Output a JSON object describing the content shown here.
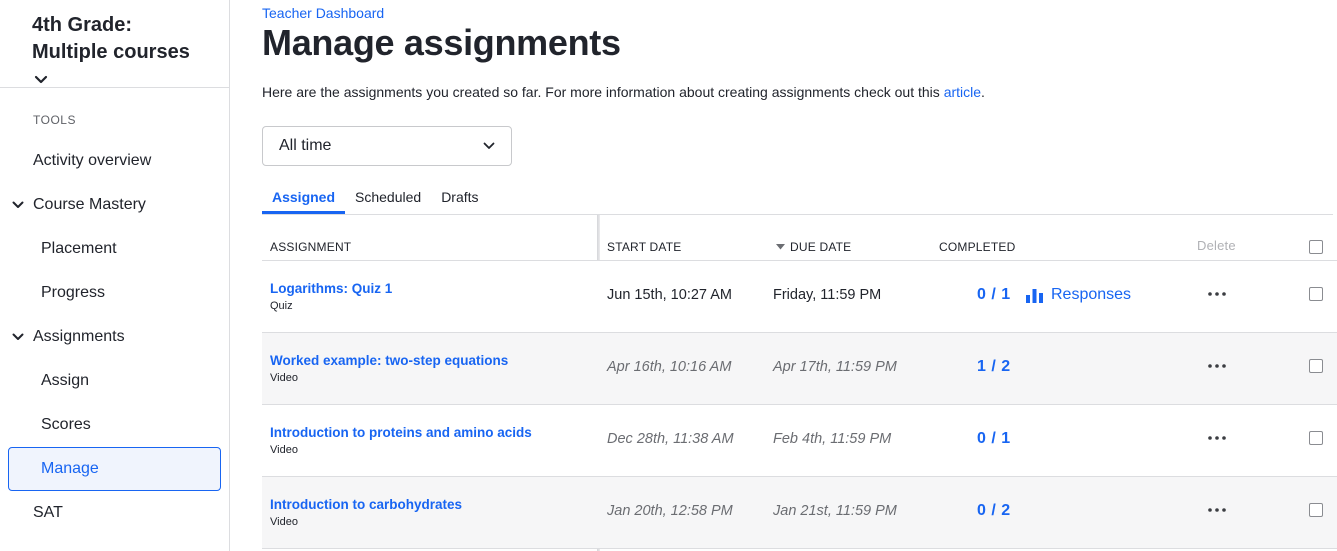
{
  "sidebar": {
    "course_title": "4th Grade: Multiple courses",
    "tools_label": "TOOLS",
    "items": [
      {
        "label": "Activity overview"
      },
      {
        "label": "Course Mastery"
      },
      {
        "label": "Placement"
      },
      {
        "label": "Progress"
      },
      {
        "label": "Assignments"
      },
      {
        "label": "Assign"
      },
      {
        "label": "Scores"
      },
      {
        "label": "Manage"
      },
      {
        "label": "SAT"
      }
    ]
  },
  "header": {
    "breadcrumb": "Teacher Dashboard",
    "title": "Manage assignments",
    "intro_text": "Here are the assignments you created so far. For more information about creating assignments check out this ",
    "intro_link": "article",
    "intro_end": "."
  },
  "filter": {
    "selected": "All time"
  },
  "tabs": [
    {
      "label": "Assigned"
    },
    {
      "label": "Scheduled"
    },
    {
      "label": "Drafts"
    }
  ],
  "table": {
    "headers": {
      "assignment": "ASSIGNMENT",
      "start_date": "START DATE",
      "due_date": "DUE DATE",
      "completed": "COMPLETED",
      "delete": "Delete"
    },
    "responses_label": "Responses",
    "rows": [
      {
        "title": "Logarithms: Quiz 1",
        "type": "Quiz",
        "start": "Jun 15th, 10:27 AM",
        "due": "Friday, 11:59 PM",
        "completed": "0 / 1"
      },
      {
        "title": "Worked example: two-step equations",
        "type": "Video",
        "start": "Apr 16th, 10:16 AM",
        "due": "Apr 17th, 11:59 PM",
        "completed": "1 / 2"
      },
      {
        "title": "Introduction to proteins and amino acids",
        "type": "Video",
        "start": "Dec 28th, 11:38 AM",
        "due": "Feb 4th, 11:59 PM",
        "completed": "0 / 1"
      },
      {
        "title": "Introduction to carbohydrates",
        "type": "Video",
        "start": "Jan 20th, 12:58 PM",
        "due": "Jan 21st, 11:59 PM",
        "completed": "0 / 2"
      }
    ]
  },
  "colors": {
    "accent": "#1865f2",
    "text": "#21242c",
    "muted": "#6b6d72"
  },
  "icons": {
    "course_dropdown": "chevron-down-icon",
    "filter_dropdown": "chevron-down-icon",
    "section_toggle": "chevron-down-icon",
    "sort": "sort-desc-icon",
    "responses": "bar-chart-icon",
    "more": "more-horizontal-icon"
  }
}
